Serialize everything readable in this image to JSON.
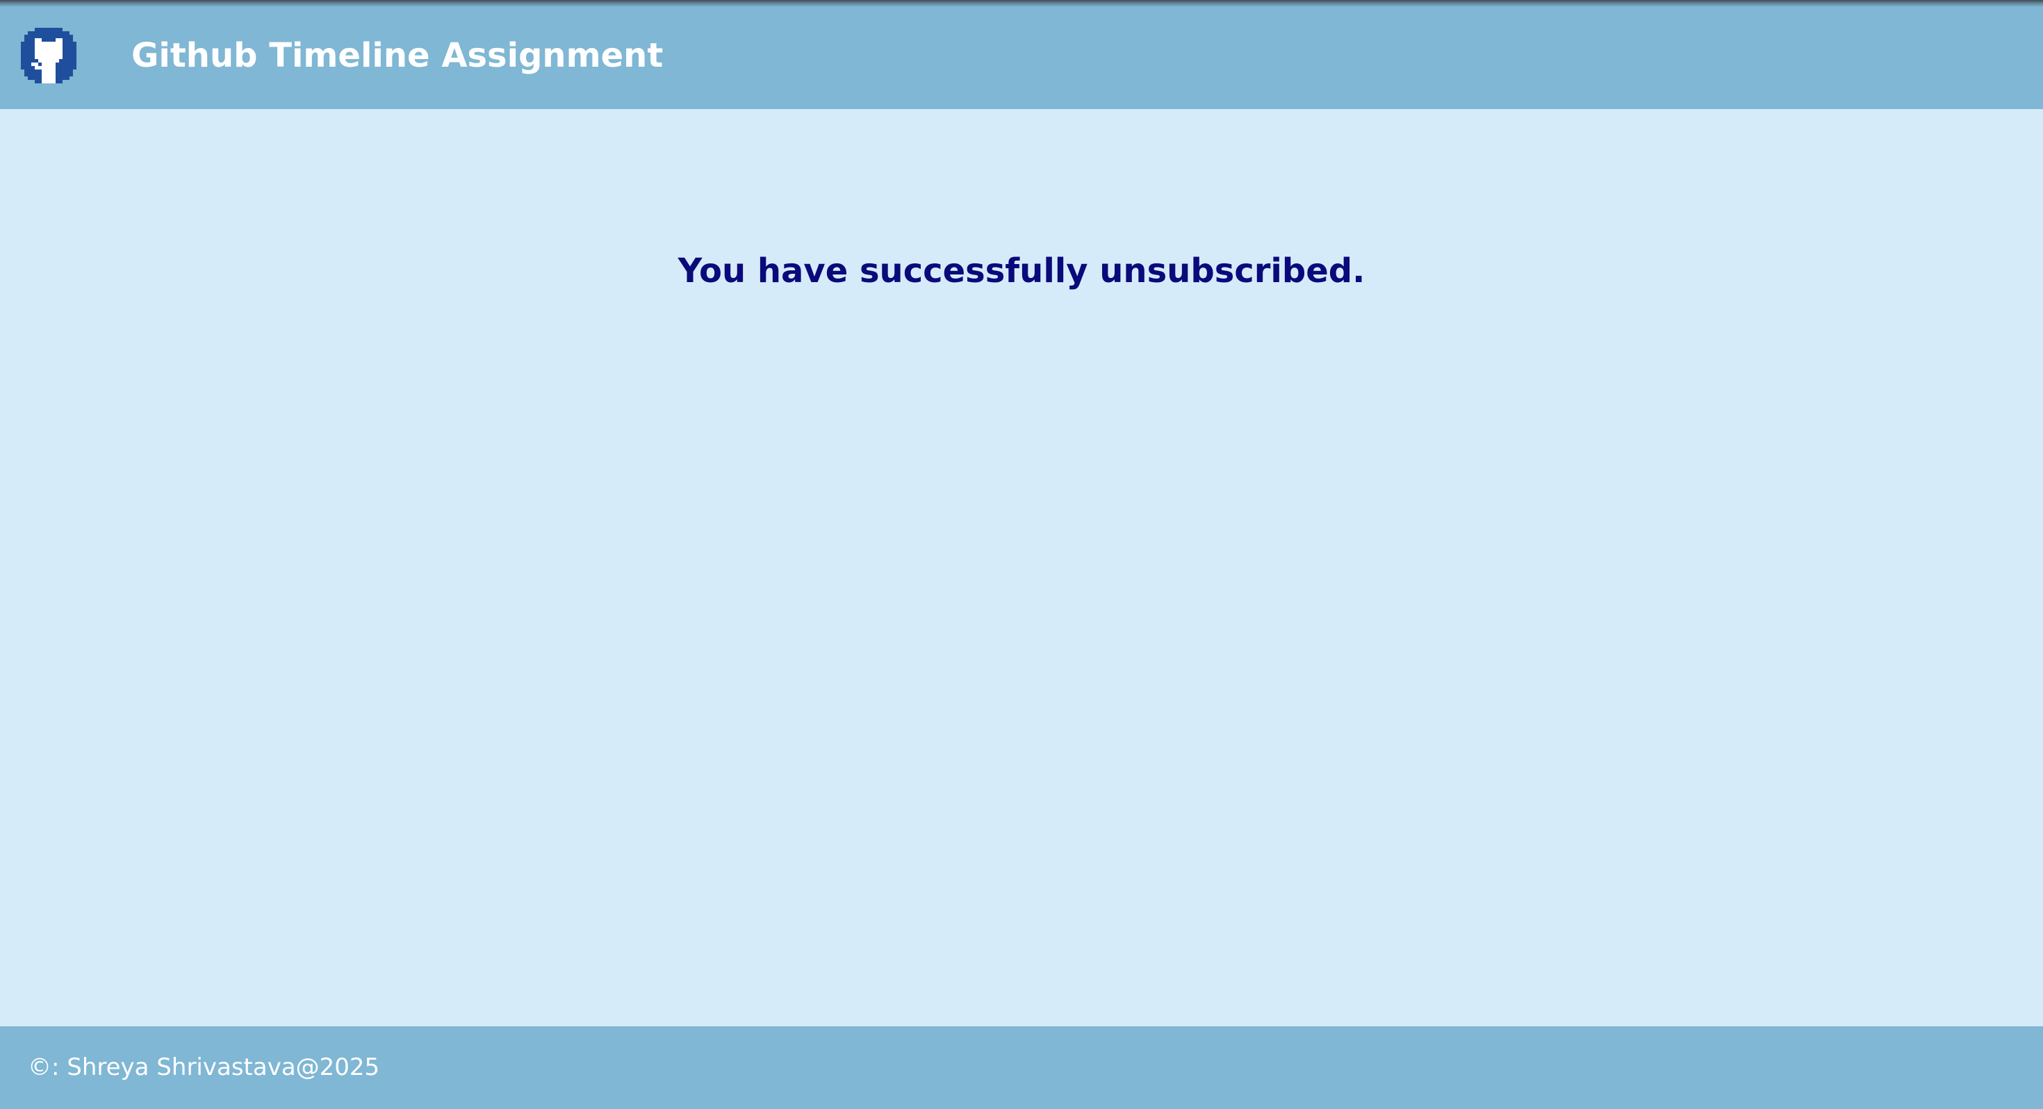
{
  "header": {
    "title": "Github Timeline Assignment",
    "logo_icon": "github-octocat-icon"
  },
  "main": {
    "message": "You have successfully unsubscribed."
  },
  "footer": {
    "copyright": "©: Shreya Shrivastava@2025"
  },
  "colors": {
    "header_bg": "#7fb7d4",
    "page_bg": "#d6ebf9",
    "message_text": "#0a0a7a",
    "logo_bg": "#1f4f9c"
  }
}
